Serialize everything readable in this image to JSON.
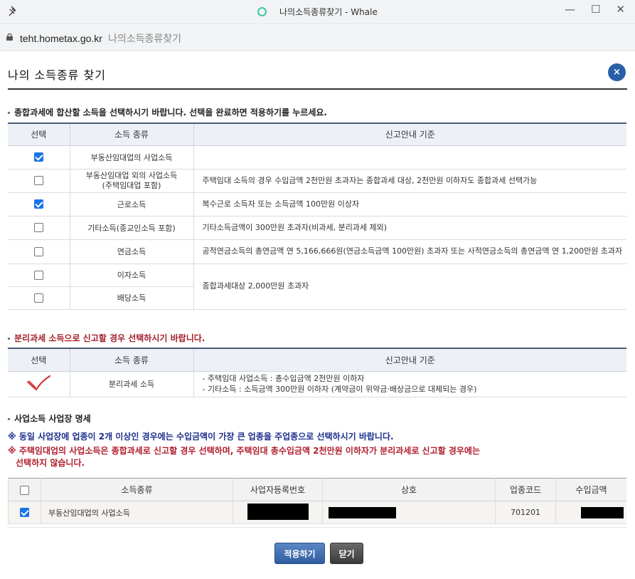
{
  "window": {
    "title": "나의소득종류찾기 - Whale"
  },
  "address": {
    "url": "teht.hometax.go.kr",
    "page_title": "나의소득종류찾기"
  },
  "popup": {
    "title": "나의 소득종류 찾기",
    "close_symbol": "×"
  },
  "section1": {
    "heading": "종합과세에 합산할 소득을 선택하시기 바랍니다. 선택을 완료하면 적용하기를 누르세요.",
    "columns": [
      "선택",
      "소득 종류",
      "신고안내 기준"
    ],
    "rows": [
      {
        "checked": true,
        "type": "부동산임대업의 사업소득",
        "guide": ""
      },
      {
        "checked": false,
        "type": "부동산임대업 외의 사업소득\n(주택임대업 포함)",
        "guide": "주택임대 소득의 경우 수입금액 2천만원 초과자는 종합과세 대상, 2천만원 이하자도 종합과세 선택가능"
      },
      {
        "checked": true,
        "type": "근로소득",
        "guide": "복수근로 소득자 또는 소득금액 100만원 이상자"
      },
      {
        "checked": false,
        "type": "기타소득(종교인소득 포함)",
        "guide": "기타소득금액이 300만원 초과자(비과세, 분리과세 제외)"
      },
      {
        "checked": false,
        "type": "연금소득",
        "guide": "공적연금소득의 총연금액 연 5,166,666원(연금소득금액 100만원) 초과자 또는 사적연금소득의 총연금액 연 1,200만원 초과자"
      },
      {
        "checked": false,
        "type": "이자소득",
        "guide": "종합과세대상 2,000만원 초과자"
      },
      {
        "checked": false,
        "type": "배당소득",
        "guide": ""
      }
    ]
  },
  "section2": {
    "heading": "분리과세 소득으로 신고할 경우 선택하시기 바랍니다.",
    "columns": [
      "선택",
      "소득 종류",
      "신고안내 기준"
    ],
    "row": {
      "type": "분리과세 소득",
      "guide_1": "- 주택임대 사업소득 : 총수입금액 2천만원 이하자",
      "guide_2": "- 기타소득 : 소득금액 300만원 이하자 (계약금이 위약금·배상금으로 대체되는 경우)"
    }
  },
  "section3": {
    "heading": "사업소득 사업장 명세",
    "notice_1": "※ 동일 사업장에 업종이 2개 이상인 경우에는 수입금액이 가장 큰 업종을 주업종으로 선택하시기 바랍니다.",
    "notice_2a": "※ 주택임대업의 사업소득은 종합과세로 신고할 경우 선택하며, 주택임대 총수입금액 2천만원 이하자가 분리과세로 신고할 경우에는",
    "notice_2b": "선택하지 않습니다.",
    "columns": [
      "소득종류",
      "사업자등록번호",
      "상호",
      "업종코드",
      "수입금액"
    ],
    "row": {
      "checked": true,
      "type": "부동산임대업의 사업소득",
      "industry_code": "701201"
    }
  },
  "buttons": {
    "apply": "적용하기",
    "close": "닫기"
  },
  "colors": {
    "accent": "#2b5fa8",
    "notice_red": "#b11e2d",
    "notice_navy": "#1d2f8c"
  }
}
